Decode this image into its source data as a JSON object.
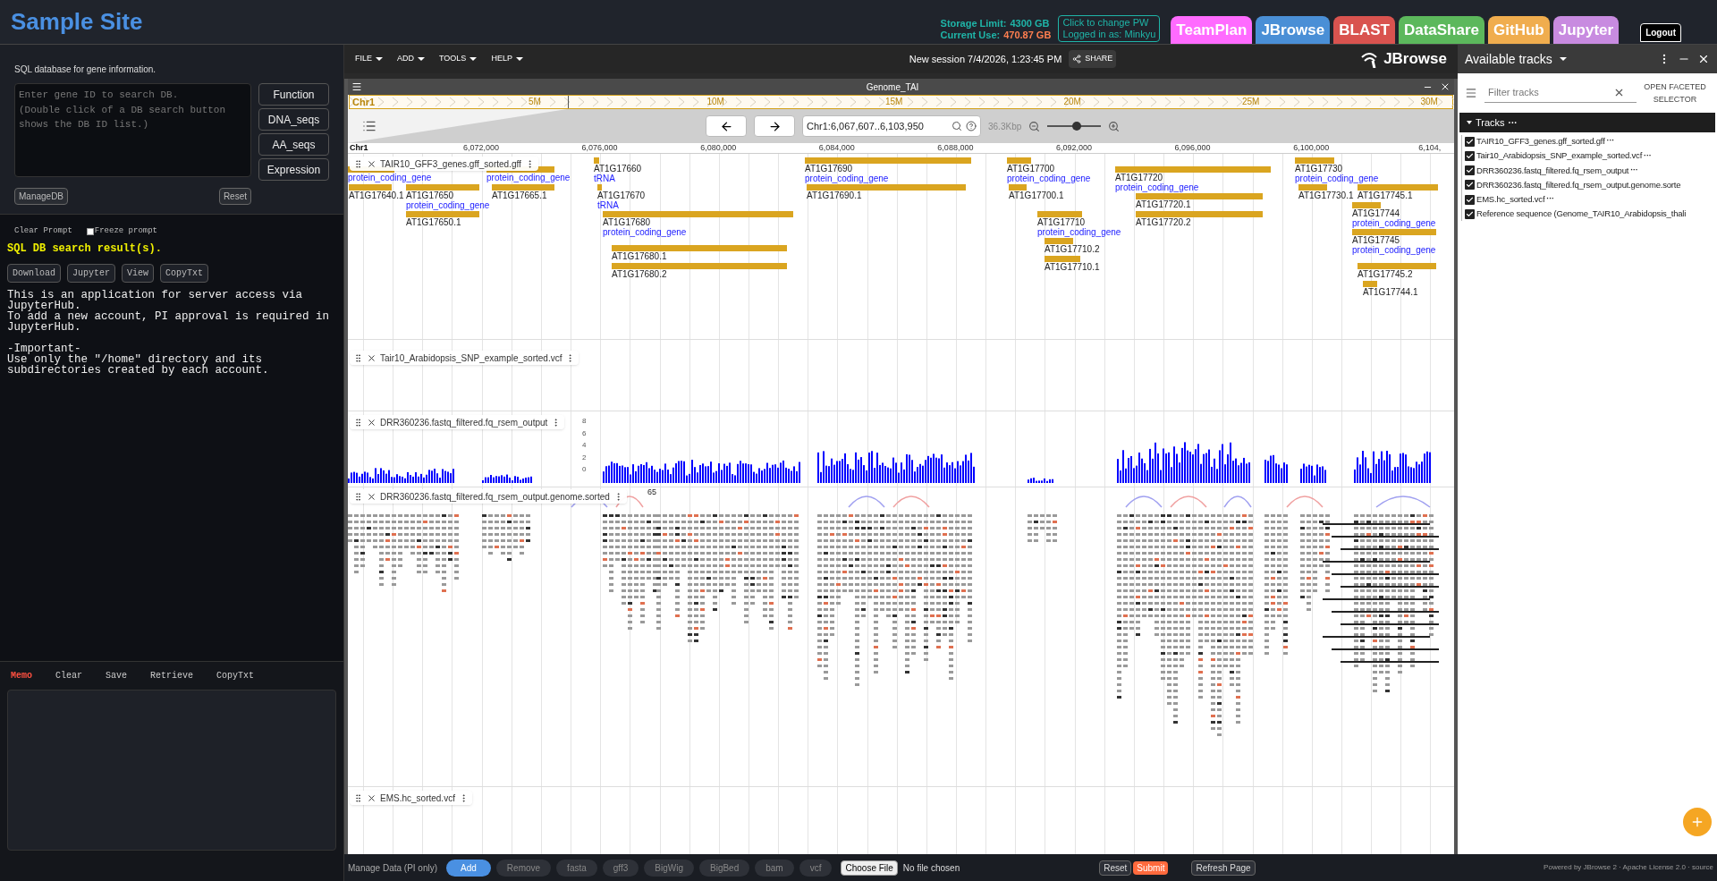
{
  "header": {
    "title": "Sample Site",
    "storage_limit_label": "Storage Limit:",
    "storage_limit": "4300 GB",
    "current_use_label": "Current Use:",
    "current_use": "470.87 GB",
    "account_lines": [
      "Click to change PW",
      "Logged in as: Minkyu"
    ],
    "nav_tabs": [
      {
        "label": "TeamPlan",
        "color": "#ff6bff"
      },
      {
        "label": "JBrowse",
        "color": "#4a8fd6"
      },
      {
        "label": "BLAST",
        "color": "#d9534f"
      },
      {
        "label": "DataShare",
        "color": "#5cb85c"
      },
      {
        "label": "GitHub",
        "color": "#f0ad4e"
      },
      {
        "label": "Jupyter",
        "color": "#c88be0"
      }
    ],
    "logout": "Logout"
  },
  "left_panel": {
    "description": "SQL database for gene information.",
    "query_placeholder": "Enter gene ID to search DB.\n(Double click of a DB search button shows the DB ID list.)",
    "search_buttons": [
      "Function",
      "DNA_seqs",
      "AA_seqs",
      "Expression"
    ],
    "manage_button": "ManageDB",
    "reset_button": "Reset",
    "clear_prompt": "Clear Prompt",
    "freeze_prompt": {
      "label": "Freeze prompt",
      "checked": false
    },
    "result_title": "SQL DB search result(s).",
    "result_buttons": [
      "Download",
      "Jupyter",
      "View",
      "CopyTxt"
    ],
    "notices": [
      [
        "This is an application for server access via JupyterHub.",
        "To add a new account, PI approval is required in JupyterHub."
      ],
      [
        "-Important-",
        "Use only the \"/home\" directory and its subdirectories created by each account."
      ]
    ],
    "memo": {
      "title": "Memo",
      "actions": [
        "Clear",
        "Save",
        "Retrieve",
        "CopyTxt"
      ]
    }
  },
  "jbrowse": {
    "menus": [
      "FILE",
      "ADD",
      "TOOLS",
      "HELP"
    ],
    "session_title": "New session 7/4/2026, 1:23:45 PM",
    "share": "SHARE",
    "logo": "JBrowse",
    "view": {
      "title": "Genome_TAI",
      "overview_chrom": "Chr1",
      "overview_ticks": [
        "5M",
        "10M",
        "15M",
        "20M",
        "25M",
        "30M"
      ],
      "locus": "Chr1:6,067,607..6,103,950",
      "span": "36.3Kbp",
      "zoom": {
        "level": 0.55
      },
      "ruler_chrom": "Chr1",
      "ruler_ticks": [
        "6,072,000",
        "6,076,000",
        "6,080,000",
        "6,084,000",
        "6,088,000",
        "6,092,000",
        "6,096,000",
        "6,100,000",
        "6,104,"
      ],
      "tracks": [
        {
          "kind": "gene",
          "name": "TAIR10_GFF3_genes.gff_sorted.gff",
          "features": [
            {
              "description": "protein_coding_gene"
            },
            {
              "description": "protein_coding_gene"
            },
            {
              "label": "AT1G17640.1"
            },
            {
              "label": "AT1G17650",
              "description": "protein_coding_gene"
            },
            {
              "label": "AT1G17665.1"
            },
            {
              "label": "AT1G17650.1"
            },
            {
              "label": "AT1G17660",
              "description": "tRNA"
            },
            {
              "label": "AT1G17670",
              "description": "tRNA"
            },
            {
              "label": "AT1G17680",
              "description": "protein_coding_gene"
            },
            {
              "label": "AT1G17680.1"
            },
            {
              "label": "AT1G17680.2"
            },
            {
              "label": "AT1G17690",
              "description": "protein_coding_gene"
            },
            {
              "label": "AT1G17690.1"
            },
            {
              "label": "AT1G17700",
              "description": "protein_coding_gene"
            },
            {
              "label": "AT1G17700.1"
            },
            {
              "label": "AT1G17710",
              "description": "protein_coding_gene"
            },
            {
              "label": "AT1G17710.2"
            },
            {
              "label": "AT1G17710.1"
            },
            {
              "label": "AT1G17720",
              "description": "protein_coding_gene"
            },
            {
              "label": "AT1G17720.1"
            },
            {
              "label": "AT1G17720.2"
            },
            {
              "label": "AT1G17730",
              "description": "protein_coding_gene"
            },
            {
              "label": "AT1G17730.1"
            },
            {
              "label": "AT1G17745.1"
            },
            {
              "label": "AT1G17744",
              "description": "protein_coding_gene"
            },
            {
              "label": "AT1G17745",
              "description": "protein_coding_gene"
            },
            {
              "label": "AT1G17745.2"
            },
            {
              "label": "AT1G17744.1"
            }
          ]
        },
        {
          "kind": "variant",
          "name": "Tair10_Arabidopsis_SNP_example_sorted.vcf"
        },
        {
          "kind": "coverage",
          "name": "DRR360236.fastq_filtered.fq_rsem_output",
          "scale": [
            "8",
            "6",
            "4",
            "2",
            "0"
          ]
        },
        {
          "kind": "alignment",
          "name": "DRR360236.fastq_filtered.fq_rsem_output.genome.sorted",
          "max": "65"
        },
        {
          "kind": "variant",
          "name": "EMS.hc_sorted.vcf"
        }
      ]
    }
  },
  "tracks_panel": {
    "title": "Available tracks",
    "filter_placeholder": "Filter tracks",
    "faceted": "OPEN FACETED SELECTOR",
    "category": "Tracks",
    "category_menu": "···",
    "items": [
      {
        "label": "TAIR10_GFF3_genes.gff_sorted.gff",
        "checked": true,
        "menu": "···"
      },
      {
        "label": "Tair10_Arabidopsis_SNP_example_sorted.vcf",
        "checked": true,
        "menu": "···"
      },
      {
        "label": "DRR360236.fastq_filtered.fq_rsem_output",
        "checked": true,
        "menu": "···"
      },
      {
        "label": "DRR360236.fastq_filtered.fq_rsem_output.genome.sorte",
        "checked": true
      },
      {
        "label": "EMS.hc_sorted.vcf",
        "checked": true,
        "menu": "···"
      },
      {
        "label": "Reference sequence (Genome_TAIR10_Arabidopsis_thali",
        "checked": true
      }
    ]
  },
  "bottom_bar": {
    "label": "Manage Data (PI only)",
    "add": "Add",
    "remove": "Remove",
    "formats": [
      "fasta",
      "gff3",
      "BigWig",
      "BigBed",
      "bam",
      "vcf"
    ],
    "file_button": "Choose File",
    "file_status": "No file chosen",
    "reset": "Reset",
    "submit": "Submit",
    "refresh": "Refresh Page",
    "footer": "Powered by JBrowse 2 · Apache License 2.0 · source"
  }
}
